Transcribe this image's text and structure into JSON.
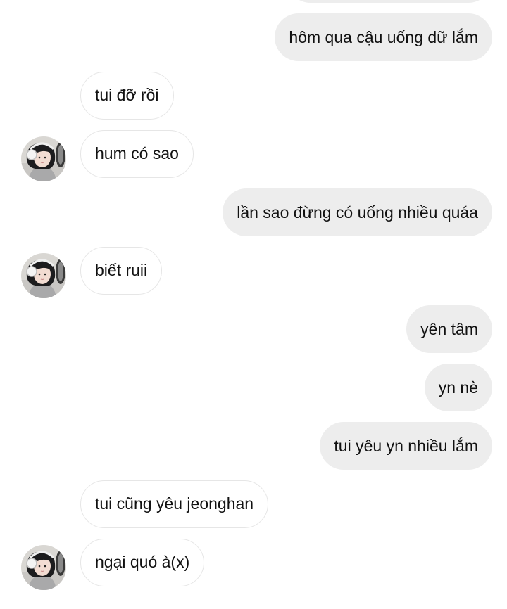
{
  "messages": [
    {
      "direction": "out",
      "text": ""
    },
    {
      "direction": "out",
      "text": "hôm qua cậu uống dữ lắm"
    },
    {
      "direction": "in",
      "text": "tui đỡ rồi",
      "avatar": false
    },
    {
      "direction": "in",
      "text": "hum có sao",
      "avatar": true
    },
    {
      "direction": "out",
      "text": "lần sao đừng có uống nhiều quáa"
    },
    {
      "direction": "in",
      "text": "biết ruii",
      "avatar": true
    },
    {
      "direction": "out",
      "text": "yên tâm"
    },
    {
      "direction": "out",
      "text": "yn nè"
    },
    {
      "direction": "out",
      "text": "tui yêu yn nhiều lắm"
    },
    {
      "direction": "in",
      "text": "tui cũng yêu jeonghan",
      "avatar": false
    },
    {
      "direction": "in",
      "text": "ngại quó à(x)",
      "avatar": true
    }
  ],
  "contact": {
    "avatar_icon": "profile-photo-girl-headphones"
  },
  "colors": {
    "outgoing_bubble": "#ededed",
    "incoming_bubble": "#ffffff",
    "incoming_border": "#e6e6e6",
    "text": "#111111"
  }
}
